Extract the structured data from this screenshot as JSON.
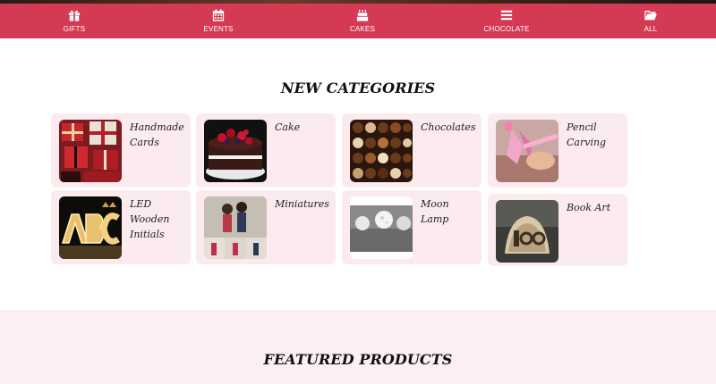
{
  "nav": {
    "items": [
      {
        "label": "GIFTS",
        "icon": "gift-icon"
      },
      {
        "label": "EVENTS",
        "icon": "calendar-icon"
      },
      {
        "label": "CAKES",
        "icon": "birthday-cake-icon"
      },
      {
        "label": "CHOCOLATE",
        "icon": "menu-bars-icon"
      },
      {
        "label": "ALL",
        "icon": "folder-open-icon"
      }
    ]
  },
  "sections": {
    "new_categories_title": "NEW CATEGORIES",
    "featured_products_title": "FEATURED PRODUCTS"
  },
  "categories": [
    {
      "name": "Handmade Cards"
    },
    {
      "name": "Cake"
    },
    {
      "name": "Chocolates"
    },
    {
      "name": "Pencil Carving"
    },
    {
      "name": "LED Wooden Initials"
    },
    {
      "name": "Miniatures"
    },
    {
      "name": "Moon Lamp"
    },
    {
      "name": "Book Art"
    }
  ],
  "colors": {
    "nav_background": "#d53a55",
    "card_background": "#fbeaee",
    "featured_background": "#fbeff1"
  }
}
